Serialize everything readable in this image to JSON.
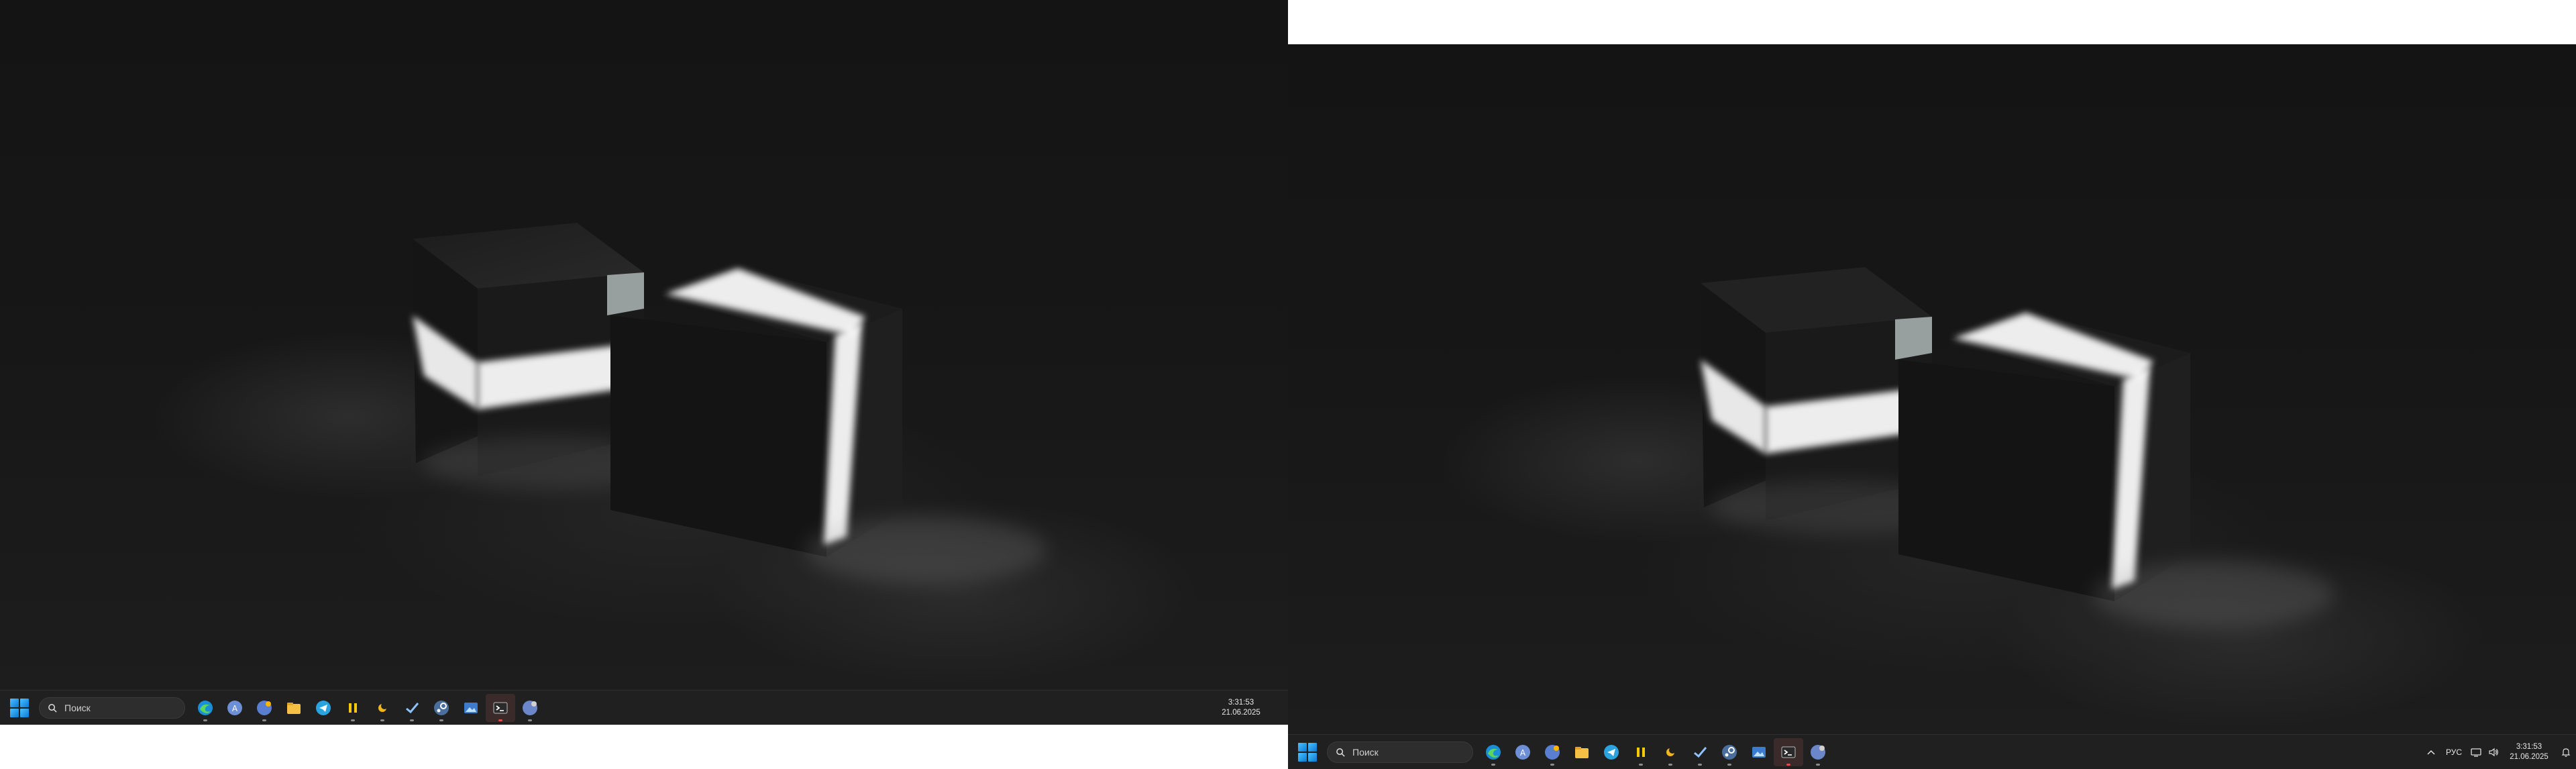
{
  "monitors": [
    {
      "taskbar": {
        "search": {
          "placeholder": "Поиск"
        },
        "pinned_apps": [
          {
            "name": "edge-icon"
          },
          {
            "name": "app-a-icon"
          },
          {
            "name": "app-b-icon"
          },
          {
            "name": "file-explorer-icon"
          },
          {
            "name": "telegram-icon"
          },
          {
            "name": "app-pause-icon"
          },
          {
            "name": "app-sun-icon"
          },
          {
            "name": "app-check-icon"
          },
          {
            "name": "steam-icon"
          },
          {
            "name": "photos-icon"
          },
          {
            "name": "terminal-icon"
          },
          {
            "name": "app-c-icon"
          }
        ],
        "clock": {
          "time": "3:31:53",
          "date": "21.06.2025"
        }
      }
    },
    {
      "taskbar": {
        "search": {
          "placeholder": "Поиск"
        },
        "pinned_apps": [
          {
            "name": "edge-icon"
          },
          {
            "name": "app-a-icon"
          },
          {
            "name": "app-b-icon"
          },
          {
            "name": "file-explorer-icon"
          },
          {
            "name": "telegram-icon"
          },
          {
            "name": "app-pause-icon"
          },
          {
            "name": "app-sun-icon"
          },
          {
            "name": "app-check-icon"
          },
          {
            "name": "steam-icon"
          },
          {
            "name": "photos-icon"
          },
          {
            "name": "terminal-icon"
          },
          {
            "name": "app-c-icon"
          }
        ],
        "tray": {
          "language": "РУС"
        },
        "clock": {
          "time": "3:31:53",
          "date": "21.06.2025"
        }
      }
    }
  ],
  "colors": {
    "taskbar_bg": "#202020",
    "accent": "#0a78d4",
    "wallpaper_glow": "#ffffff"
  }
}
